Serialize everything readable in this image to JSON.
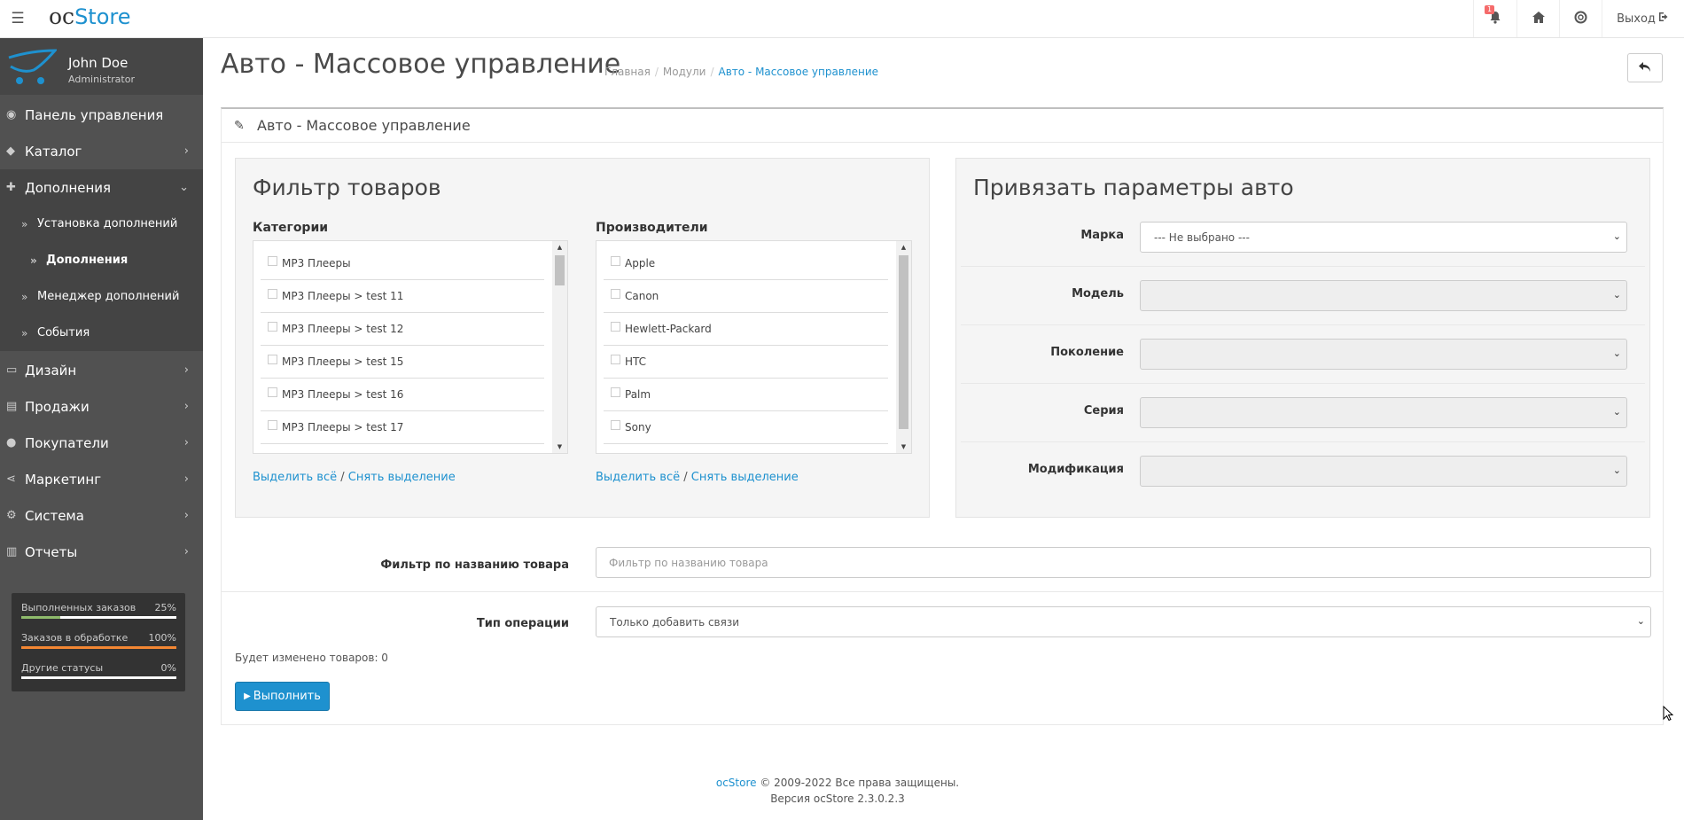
{
  "header": {
    "logo_main": "oc",
    "logo_accent": "Store",
    "notification_count": "1",
    "logout_label": "Выход"
  },
  "sidebar": {
    "user_name": "John Doe",
    "user_role": "Administrator",
    "items": [
      {
        "label": "Панель управления",
        "icon": "dashboard-icon"
      },
      {
        "label": "Каталог",
        "icon": "tags-icon"
      },
      {
        "label": "Дополнения",
        "icon": "puzzle-icon"
      },
      {
        "label": "Дизайн",
        "icon": "monitor-icon"
      },
      {
        "label": "Продажи",
        "icon": "cart-icon"
      },
      {
        "label": "Покупатели",
        "icon": "user-icon"
      },
      {
        "label": "Маркетинг",
        "icon": "share-icon"
      },
      {
        "label": "Система",
        "icon": "gear-icon"
      },
      {
        "label": "Отчеты",
        "icon": "bar-chart-icon"
      }
    ],
    "subitems": [
      {
        "label": "Установка дополнений"
      },
      {
        "label": "Дополнения"
      },
      {
        "label": "Менеджер дополнений"
      },
      {
        "label": "События"
      }
    ],
    "stats": [
      {
        "label": "Выполненных заказов",
        "value": "25%",
        "percent": 25,
        "color": "#8fbb6c"
      },
      {
        "label": "Заказов в обработке",
        "value": "100%",
        "percent": 100,
        "color": "#f38733"
      },
      {
        "label": "Другие статусы",
        "value": "0%",
        "percent": 0,
        "color": "#1e91cf"
      }
    ]
  },
  "page": {
    "title": "Авто - Массовое управление",
    "breadcrumb": [
      "Главная",
      "Модули",
      "Авто - Массовое управление"
    ],
    "panel_title": "Авто - Массовое управление"
  },
  "filter": {
    "title": "Фильтр товаров",
    "categories_label": "Категории",
    "manufacturers_label": "Производители",
    "categories": [
      "MP3 Плееры",
      "MP3 Плееры  >  test 11",
      "MP3 Плееры  >  test 12",
      "MP3 Плееры  >  test 15",
      "MP3 Плееры  >  test 16",
      "MP3 Плееры  >  test 17"
    ],
    "manufacturers": [
      "Apple",
      "Canon",
      "Hewlett-Packard",
      "HTC",
      "Palm",
      "Sony"
    ],
    "select_all": "Выделить всё",
    "deselect": "Снять выделение"
  },
  "car": {
    "title": "Привязать параметры авто",
    "fields": [
      {
        "label": "Марка",
        "value": "--- Не выбрано ---"
      },
      {
        "label": "Модель",
        "value": ""
      },
      {
        "label": "Поколение",
        "value": ""
      },
      {
        "label": "Серия",
        "value": ""
      },
      {
        "label": "Модификация",
        "value": ""
      }
    ]
  },
  "name_filter": {
    "label": "Фильтр по названию товара",
    "placeholder": "Фильтр по названию товара"
  },
  "operation": {
    "label": "Тип операции",
    "value": "Только добавить связи"
  },
  "count_text": "Будет изменено товаров: 0",
  "run_label": "Выполнить",
  "footer": {
    "link": "ocStore",
    "copyright": "© 2009-2022 Все права защищены.",
    "version": "Версия ocStore 2.3.0.2.3"
  }
}
